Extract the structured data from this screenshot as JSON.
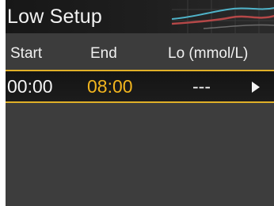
{
  "title": "Low Setup",
  "columns": {
    "start": "Start",
    "end": "End",
    "lo": "Lo (mmol/L)"
  },
  "rows": [
    {
      "start": "00:00",
      "end": "08:00",
      "lo": "---",
      "icon": "play-arrow-icon"
    }
  ],
  "colors": {
    "accent": "#e0b028",
    "selected_value": "#f2b51e",
    "background": "#3f3f3f"
  }
}
